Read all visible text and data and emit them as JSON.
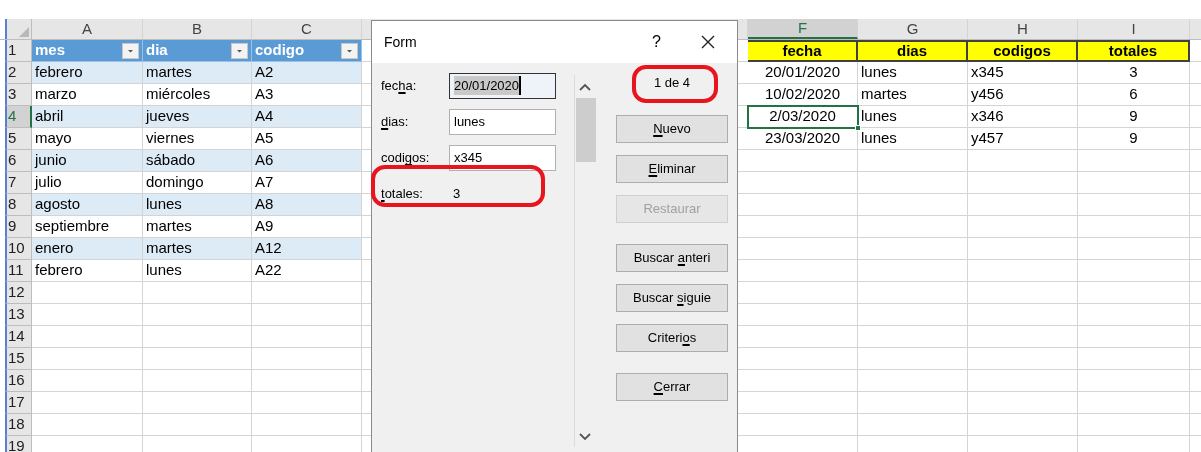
{
  "sheet": {
    "left_columns": [
      {
        "label": "A"
      },
      {
        "label": "B"
      },
      {
        "label": "C"
      }
    ],
    "right_columns": [
      {
        "label": "F"
      },
      {
        "label": "G"
      },
      {
        "label": "H"
      },
      {
        "label": "I"
      }
    ],
    "rows": [
      {
        "number": "1",
        "banded": false,
        "left": [
          {
            "kind": "filter_header",
            "text": "mes",
            "selected": false
          },
          {
            "kind": "filter_header",
            "text": "dia",
            "selected": false
          },
          {
            "kind": "filter_header",
            "text": "codigo",
            "selected": false
          }
        ],
        "right": [
          {
            "kind": "yellow_header",
            "text": "fecha",
            "selected": false
          },
          {
            "kind": "yellow_header",
            "text": "dias",
            "selected": false
          },
          {
            "kind": "yellow_header",
            "text": "codigos",
            "selected": false
          },
          {
            "kind": "yellow_header",
            "text": "totales",
            "selected": false
          }
        ]
      },
      {
        "number": "2",
        "banded": true,
        "left": [
          {
            "kind": "data",
            "text": "febrero",
            "selected": false
          },
          {
            "kind": "data",
            "text": "martes",
            "selected": false
          },
          {
            "kind": "data",
            "text": "A2",
            "selected": false
          }
        ],
        "right": [
          {
            "kind": "data",
            "text": "20/01/2020",
            "selected": false
          },
          {
            "kind": "data",
            "text": "lunes",
            "selected": false
          },
          {
            "kind": "data",
            "text": "x345",
            "selected": false
          },
          {
            "kind": "data",
            "text": "3",
            "selected": false
          }
        ]
      },
      {
        "number": "3",
        "banded": false,
        "left": [
          {
            "kind": "data",
            "text": "marzo",
            "selected": false
          },
          {
            "kind": "data",
            "text": "miércoles",
            "selected": false
          },
          {
            "kind": "data",
            "text": "A3",
            "selected": false
          }
        ],
        "right": [
          {
            "kind": "data",
            "text": "10/02/2020",
            "selected": false
          },
          {
            "kind": "data",
            "text": "martes",
            "selected": false
          },
          {
            "kind": "data",
            "text": "y456",
            "selected": false
          },
          {
            "kind": "data",
            "text": "6",
            "selected": false
          }
        ]
      },
      {
        "number": "4",
        "banded": true,
        "left": [
          {
            "kind": "data",
            "text": "abril",
            "selected": false
          },
          {
            "kind": "data",
            "text": "jueves",
            "selected": false
          },
          {
            "kind": "data",
            "text": "A4",
            "selected": false
          }
        ],
        "right": [
          {
            "kind": "data",
            "text": "2/03/2020",
            "selected": true
          },
          {
            "kind": "data",
            "text": "lunes",
            "selected": false
          },
          {
            "kind": "data",
            "text": "x346",
            "selected": false
          },
          {
            "kind": "data",
            "text": "9",
            "selected": false
          }
        ]
      },
      {
        "number": "5",
        "banded": false,
        "left": [
          {
            "kind": "data",
            "text": "mayo",
            "selected": false
          },
          {
            "kind": "data",
            "text": "viernes",
            "selected": false
          },
          {
            "kind": "data",
            "text": "A5",
            "selected": false
          }
        ],
        "right": [
          {
            "kind": "data",
            "text": "23/03/2020",
            "selected": false
          },
          {
            "kind": "data",
            "text": "lunes",
            "selected": false
          },
          {
            "kind": "data",
            "text": "y457",
            "selected": false
          },
          {
            "kind": "data",
            "text": "9",
            "selected": false
          }
        ]
      },
      {
        "number": "6",
        "banded": true,
        "left": [
          {
            "kind": "data",
            "text": "junio",
            "selected": false
          },
          {
            "kind": "data",
            "text": "sábado",
            "selected": false
          },
          {
            "kind": "data",
            "text": "A6",
            "selected": false
          }
        ],
        "right": []
      },
      {
        "number": "7",
        "banded": false,
        "left": [
          {
            "kind": "data",
            "text": "julio",
            "selected": false
          },
          {
            "kind": "data",
            "text": "domingo",
            "selected": false
          },
          {
            "kind": "data",
            "text": "A7",
            "selected": false
          }
        ],
        "right": []
      },
      {
        "number": "8",
        "banded": true,
        "left": [
          {
            "kind": "data",
            "text": "agosto",
            "selected": false
          },
          {
            "kind": "data",
            "text": "lunes",
            "selected": false
          },
          {
            "kind": "data",
            "text": "A8",
            "selected": false
          }
        ],
        "right": []
      },
      {
        "number": "9",
        "banded": false,
        "left": [
          {
            "kind": "data",
            "text": "septiembre",
            "selected": false
          },
          {
            "kind": "data",
            "text": "martes",
            "selected": false
          },
          {
            "kind": "data",
            "text": "A9",
            "selected": false
          }
        ],
        "right": []
      },
      {
        "number": "10",
        "banded": true,
        "left": [
          {
            "kind": "data",
            "text": "enero",
            "selected": false
          },
          {
            "kind": "data",
            "text": "martes",
            "selected": false
          },
          {
            "kind": "data",
            "text": "A12",
            "selected": false
          }
        ],
        "right": []
      },
      {
        "number": "11",
        "banded": false,
        "left": [
          {
            "kind": "data",
            "text": "febrero",
            "selected": false
          },
          {
            "kind": "data",
            "text": "lunes",
            "selected": false
          },
          {
            "kind": "data",
            "text": "A22",
            "selected": false
          }
        ],
        "right": []
      },
      {
        "number": "12",
        "banded": false,
        "left": [],
        "right": []
      },
      {
        "number": "13",
        "banded": false,
        "left": [],
        "right": []
      },
      {
        "number": "14",
        "banded": false,
        "left": [],
        "right": []
      },
      {
        "number": "15",
        "banded": false,
        "left": [],
        "right": []
      },
      {
        "number": "16",
        "banded": false,
        "left": [],
        "right": []
      },
      {
        "number": "17",
        "banded": false,
        "left": [],
        "right": []
      },
      {
        "number": "18",
        "banded": false,
        "left": [],
        "right": []
      },
      {
        "number": "19",
        "banded": false,
        "left": [],
        "right": []
      }
    ]
  },
  "dialog": {
    "title": "Form",
    "help": "?",
    "record_counter": {
      "text": "1 de 4",
      "circled": true
    },
    "fields": [
      {
        "kind": "input",
        "label": [
          {
            "t": "fec",
            "u": false
          },
          {
            "t": "h",
            "u": true
          },
          {
            "t": "a:",
            "u": false
          }
        ],
        "value": "20/01/2020",
        "focused": true,
        "circled": false
      },
      {
        "kind": "input",
        "label": [
          {
            "t": "d",
            "u": true
          },
          {
            "t": "ias:",
            "u": false
          }
        ],
        "value": "lunes",
        "focused": false,
        "circled": false
      },
      {
        "kind": "input",
        "label": [
          {
            "t": "codi",
            "u": false
          },
          {
            "t": "g",
            "u": true
          },
          {
            "t": "os:",
            "u": false
          }
        ],
        "value": "x345",
        "focused": false,
        "circled": false
      },
      {
        "kind": "static",
        "label": [
          {
            "t": "t",
            "u": true
          },
          {
            "t": "otales:",
            "u": false
          }
        ],
        "value": "3",
        "circled": true
      }
    ],
    "button_groups": [
      [
        {
          "label": [
            {
              "t": "N",
              "u": true
            },
            {
              "t": "uevo",
              "u": false
            }
          ],
          "disabled": false
        },
        {
          "label": [
            {
              "t": "E",
              "u": true
            },
            {
              "t": "liminar",
              "u": false
            }
          ],
          "disabled": false
        },
        {
          "label": [
            {
              "t": "Restaurar",
              "u": false
            }
          ],
          "disabled": true
        }
      ],
      [
        {
          "label": [
            {
              "t": "Buscar ",
              "u": false
            },
            {
              "t": "a",
              "u": true
            },
            {
              "t": "nteri",
              "u": false
            }
          ],
          "disabled": false
        },
        {
          "label": [
            {
              "t": "Buscar ",
              "u": false
            },
            {
              "t": "s",
              "u": true
            },
            {
              "t": "iguie",
              "u": false
            }
          ],
          "disabled": false
        },
        {
          "label": [
            {
              "t": "Criteri",
              "u": false
            },
            {
              "t": "o",
              "u": true
            },
            {
              "t": "s",
              "u": false
            }
          ],
          "disabled": false
        }
      ],
      [
        {
          "label": [
            {
              "t": "C",
              "u": true
            },
            {
              "t": "errar",
              "u": false
            }
          ],
          "disabled": false
        }
      ]
    ]
  }
}
